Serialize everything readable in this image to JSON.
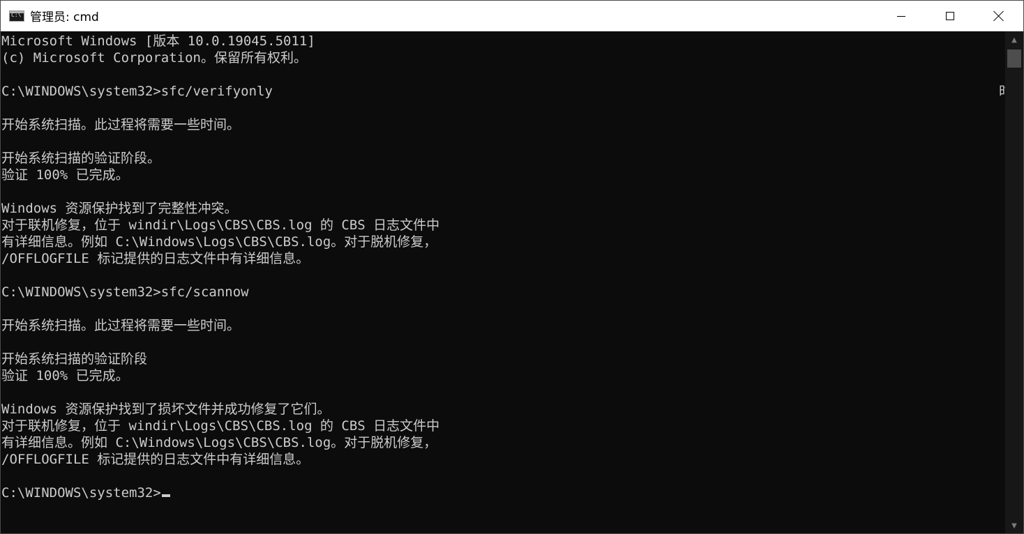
{
  "window": {
    "title": "管理员: cmd",
    "icon": "cmd-console-icon",
    "icon_prompt": "C:\\",
    "controls": {
      "minimize_icon": "minimize-icon",
      "maximize_icon": "maximize-icon",
      "close_icon": "close-icon"
    }
  },
  "console": {
    "lines": [
      "Microsoft Windows [版本 10.0.19045.5011]",
      "(c) Microsoft Corporation。保留所有权利。",
      "",
      "C:\\WINDOWS\\system32>sfc/verifyonly",
      "",
      "开始系统扫描。此过程将需要一些时间。",
      "",
      "开始系统扫描的验证阶段。",
      "验证 100% 已完成。",
      "",
      "Windows 资源保护找到了完整性冲突。",
      "对于联机修复，位于 windir\\Logs\\CBS\\CBS.log 的 CBS 日志文件中",
      "有详细信息。例如 C:\\Windows\\Logs\\CBS\\CBS.log。对于脱机修复，",
      "/OFFLOGFILE 标记提供的日志文件中有详细信息。",
      "",
      "C:\\WINDOWS\\system32>sfc/scannow",
      "",
      "开始系统扫描。此过程将需要一些时间。",
      "",
      "开始系统扫描的验证阶段",
      "验证 100% 已完成。",
      "",
      "Windows 资源保护找到了损坏文件并成功修复了它们。",
      "对于联机修复，位于 windir\\Logs\\CBS\\CBS.log 的 CBS 日志文件中",
      "有详细信息。例如 C:\\Windows\\Logs\\CBS\\CBS.log。对于脱机修复，",
      "/OFFLOGFILE 标记提供的日志文件中有详细信息。",
      "",
      "C:\\WINDOWS\\system32>"
    ],
    "stray_char": "时",
    "colors": {
      "background": "#0c0c0c",
      "text": "#cccccc"
    }
  },
  "scrollbar": {
    "up_arrow": "▲",
    "down_arrow": "▼"
  }
}
